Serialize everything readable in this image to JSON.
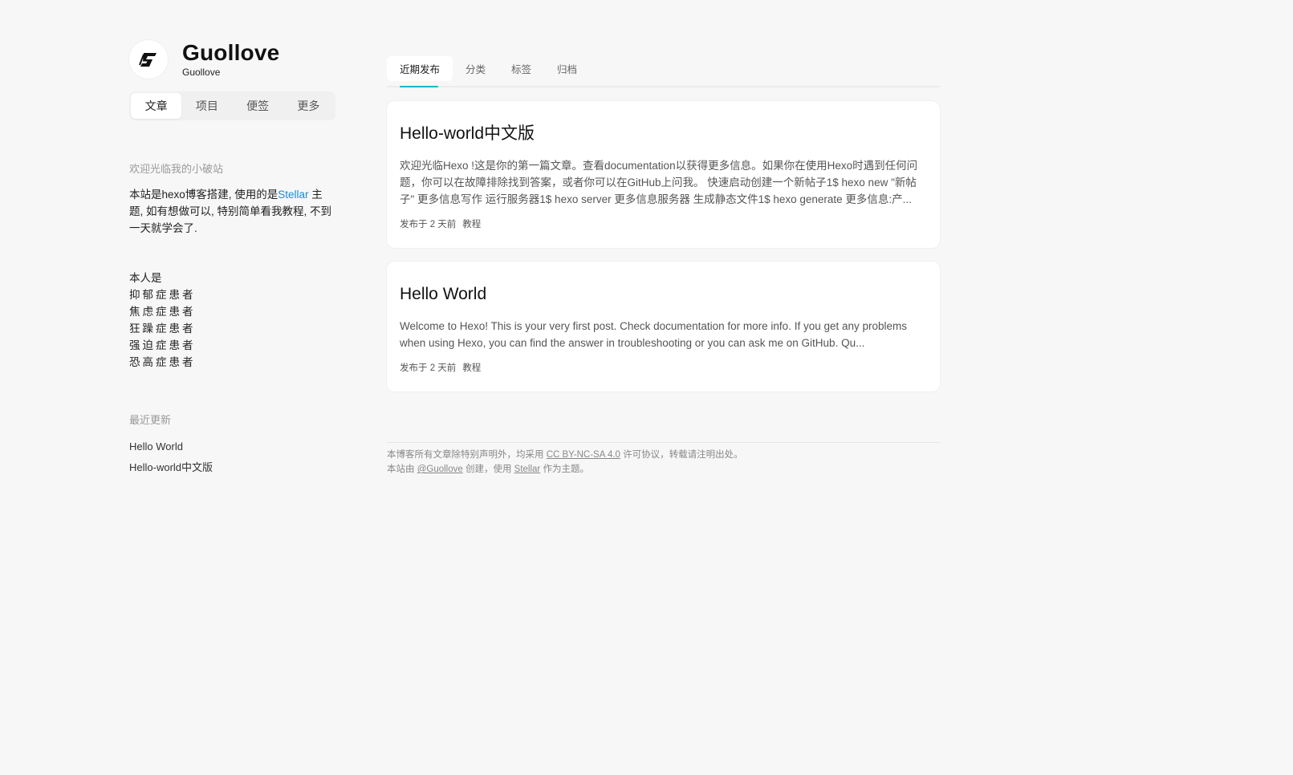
{
  "site": {
    "title": "Guollove",
    "subtitle": "Guollove"
  },
  "nav_tabs": [
    {
      "label": "文章",
      "active": true
    },
    {
      "label": "项目",
      "active": false
    },
    {
      "label": "便签",
      "active": false
    },
    {
      "label": "更多",
      "active": false
    }
  ],
  "welcome": {
    "title": "欢迎光临我的小破站",
    "text_before": "本站是hexo博客搭建, 使用的是",
    "link": "Stellar",
    "text_after": " 主题, 如有想做可以, 特别简单看我教程, 不到一天就学会了."
  },
  "intro": {
    "lead": "本人是",
    "lines": [
      "抑郁症患者",
      "焦虑症患者",
      "狂躁症患者",
      "强迫症患者",
      "恐高症患者"
    ]
  },
  "recent": {
    "title": "最近更新",
    "items": [
      "Hello World",
      "Hello-world中文版"
    ]
  },
  "main_tabs": [
    {
      "label": "近期发布",
      "active": true
    },
    {
      "label": "分类",
      "active": false
    },
    {
      "label": "标签",
      "active": false
    },
    {
      "label": "归档",
      "active": false
    }
  ],
  "posts": [
    {
      "title": "Hello-world中文版",
      "excerpt": "欢迎光临Hexo !这是你的第一篇文章。查看documentation以获得更多信息。如果你在使用Hexo时遇到任何问题，你可以在故障排除找到答案，或者你可以在GitHub上问我。 快速启动创建一个新帖子1$ hexo new \"新帖子\" 更多信息写作 运行服务器1$ hexo server 更多信息服务器 生成静态文件1$ hexo generate 更多信息:产...",
      "date": "发布于 2 天前",
      "category": "教程"
    },
    {
      "title": "Hello World",
      "excerpt": "Welcome to Hexo! This is your very first post. Check documentation for more info. If you get any problems when using Hexo, you can find the answer in troubleshooting or you can ask me on GitHub. Qu...",
      "date": "发布于 2 天前",
      "category": "教程"
    }
  ],
  "footer": {
    "line1_before": "本博客所有文章除特别声明外，均采用 ",
    "license": "CC BY-NC-SA 4.0",
    "line1_after": " 许可协议，转载请注明出处。",
    "line2_before": "本站由 ",
    "author": "@Guollove",
    "line2_mid": " 创建，使用 ",
    "theme": "Stellar",
    "line2_after": " 作为主题。"
  },
  "colors": {
    "accent": "#1cb5c7",
    "link": "#1c8ad8",
    "background": "#f7f7f7"
  }
}
